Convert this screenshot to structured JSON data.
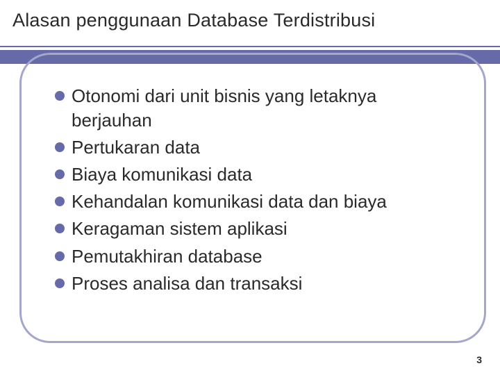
{
  "slide": {
    "title": "Alasan penggunaan Database Terdistribusi",
    "bullets": [
      "Otonomi dari unit bisnis yang letaknya berjauhan",
      "Pertukaran data",
      "Biaya komunikasi data",
      "Kehandalan komunikasi data dan biaya",
      "Keragaman sistem aplikasi",
      "Pemutakhiran database",
      "Proses analisa dan transaksi"
    ],
    "page_number": "3"
  }
}
